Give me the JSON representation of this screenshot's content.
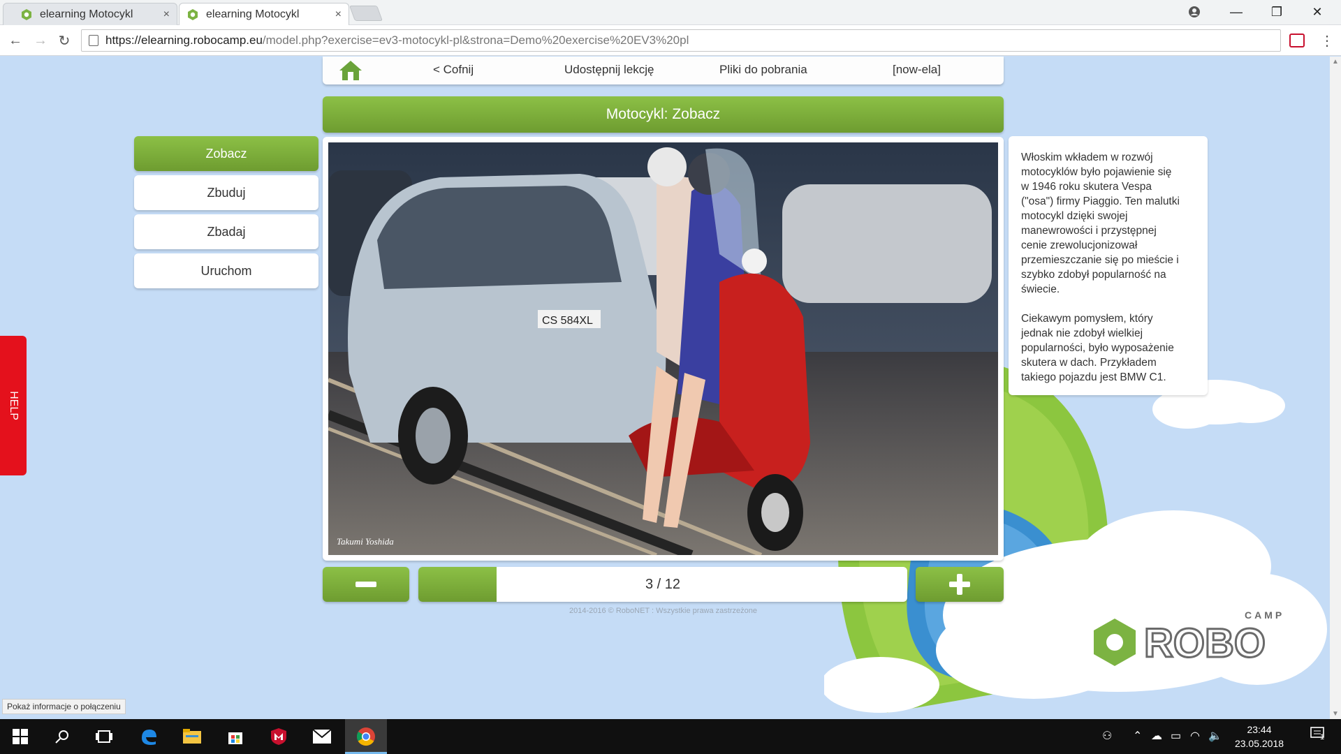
{
  "browser": {
    "tabs": [
      {
        "title": "elearning Motocykl",
        "close": "×",
        "active": false
      },
      {
        "title": "elearning Motocykl",
        "close": "×",
        "active": true
      }
    ],
    "window_controls": {
      "minimize": "—",
      "restore": "❐",
      "close": "✕"
    },
    "nav": {
      "back": "←",
      "forward": "→",
      "reload": "↻"
    },
    "url_host": "https://elearning.robocamp.eu",
    "url_path": "/model.php?exercise=ev3-motocykl-pl&strona=Demo%20exercise%20EV3%20pl",
    "menu": "⋮"
  },
  "topnav": {
    "home_icon": "home-icon",
    "back": "< Cofnij",
    "share": "Udostępnij lekcję",
    "downloads": "Pliki do pobrania",
    "user": "[now-ela]"
  },
  "title": "Motocykl: Zobacz",
  "sidebar": {
    "items": [
      {
        "label": "Zobacz",
        "active": true
      },
      {
        "label": "Zbuduj",
        "active": false
      },
      {
        "label": "Zbadaj",
        "active": false
      },
      {
        "label": "Uruchom",
        "active": false
      }
    ]
  },
  "photo": {
    "credit": "Takumi Yoshida",
    "plate": "CS 584XL"
  },
  "description": {
    "paragraphs": [
      "Włoskim wkładem w rozwój\nmotocyklów było pojawienie się\nw 1946 roku skutera Vespa\n(\"osa\") firmy Piaggio. Ten malutki\nmotocykl dzięki swojej\nmanewrowości i przystępnej\ncenie zrewolucjonizował\nprzemieszczanie się po mieście i\nszybko zdobył popularność na\nświecie.",
      "Ciekawym pomysłem, który\njednak nie zdobył wielkiej\npopularności, było wyposażenie\nskutera w dach. Przykładem\ntakiego pojazdu jest BMW C1."
    ]
  },
  "pager": {
    "current": 3,
    "total": 12,
    "label": "3 / 12",
    "progress_fraction": 0.16
  },
  "footer": "2014-2016 © RoboNET : Wszystkie prawa zastrzeżone",
  "help": "HELP",
  "logo": {
    "text": "ROBO",
    "small": "CAMP"
  },
  "status_bubble": "Pokaż informacje o połączeniu",
  "taskbar": {
    "time": "23:44",
    "date": "23.05.2018",
    "notifications": "1"
  },
  "colors": {
    "accent_green": "#7aae38",
    "help_red": "#e4111c",
    "page_bg": "#c5dcf6"
  }
}
